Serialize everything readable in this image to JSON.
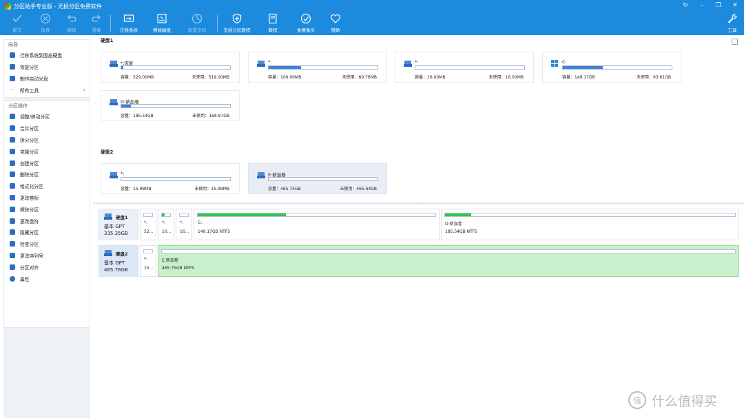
{
  "window": {
    "title": "分区助手专业版 - 无损分区免费软件"
  },
  "toolbar": {
    "buttons": [
      {
        "label": "提交",
        "icon": "check-icon",
        "enabled": false
      },
      {
        "label": "放弃",
        "icon": "discard-icon",
        "enabled": false
      },
      {
        "label": "撤销",
        "icon": "undo-icon",
        "enabled": false
      },
      {
        "label": "重做",
        "icon": "redo-icon",
        "enabled": false
      },
      {
        "label": "迁移系统",
        "icon": "migrate-os-icon",
        "enabled": true
      },
      {
        "label": "擦除磁盘",
        "icon": "wipe-disk-icon",
        "enabled": true
      },
      {
        "label": "配置空间",
        "icon": "allocate-space-icon",
        "enabled": false
      },
      {
        "label": "无损分区教程",
        "icon": "shield-icon",
        "enabled": true
      },
      {
        "label": "教程",
        "icon": "book-icon",
        "enabled": true
      },
      {
        "label": "免费备份",
        "icon": "backup-icon",
        "enabled": true
      },
      {
        "label": "赞助",
        "icon": "heart-icon",
        "enabled": true
      }
    ],
    "tools_label": "工具"
  },
  "sidebar": {
    "wizard_header": "向导",
    "wizard_items": [
      "迁移系统到固态硬盘",
      "恢复分区",
      "制作启动光盘",
      "所有工具"
    ],
    "ops_header": "分区操作",
    "ops_items": [
      "调整/移动分区",
      "合并分区",
      "拆分分区",
      "克隆分区",
      "创建分区",
      "删除分区",
      "格式化分区",
      "更改卷标",
      "擦除分区",
      "更改盘符",
      "隐藏分区",
      "检查分区",
      "更改序列号",
      "分区对齐",
      "属性"
    ]
  },
  "disks_view": {
    "disk1_label": "硬盘1",
    "disk1_partitions": [
      {
        "name": "*:恢复",
        "capacity": "容量：529.00MB",
        "free": "未使用：519.00MB",
        "used_fraction": 0.02
      },
      {
        "name": "*:",
        "capacity": "容量：100.00MB",
        "free": "未使用：69.76MB",
        "used_fraction": 0.3
      },
      {
        "name": "*:",
        "capacity": "容量：16.00MB",
        "free": "未使用：16.00MB",
        "used_fraction": 0.0
      },
      {
        "name": "C:",
        "capacity": "容量：149.17GB",
        "free": "未使用：93.61GB",
        "used_fraction": 0.37
      },
      {
        "name": "D:新加卷",
        "capacity": "容量：185.54GB",
        "free": "未使用：168.87GB",
        "used_fraction": 0.09
      }
    ],
    "disk2_label": "硬盘2",
    "disk2_partitions": [
      {
        "name": "*:",
        "capacity": "容量：15.98MB",
        "free": "未使用：15.98MB",
        "used_fraction": 0.0
      },
      {
        "name": "E:新加卷",
        "capacity": "容量：465.75GB",
        "free": "未使用：465.64GB",
        "used_fraction": 0.0
      }
    ]
  },
  "disk_map": {
    "disk1": {
      "name": "硬盘1",
      "type": "基本 GPT",
      "size": "335.35GB",
      "partitions": [
        {
          "name": "*:",
          "info": "52...",
          "used_fraction": 0.0
        },
        {
          "name": "*:",
          "info": "10...",
          "used_fraction": 0.3
        },
        {
          "name": "*:",
          "info": "16...",
          "used_fraction": 0.0
        },
        {
          "name": "C:",
          "info": "149.17GB NTFS",
          "used_fraction": 0.37
        },
        {
          "name": "D:新加卷",
          "info": "185.54GB NTFS",
          "used_fraction": 0.09
        }
      ]
    },
    "disk2": {
      "name": "硬盘2",
      "type": "基本 GPT",
      "size": "465.76GB",
      "partitions": [
        {
          "name": "*:",
          "info": "15...",
          "used_fraction": 0.0
        },
        {
          "name": "E:新加卷",
          "info": "465.75GB NTFS",
          "used_fraction": 0.0
        }
      ]
    }
  },
  "watermark": {
    "text": "什么值得买",
    "logo": "值"
  },
  "colors": {
    "accent": "#1c8bde",
    "bar_blue": "#3f82d8",
    "bar_green": "#31c451",
    "selected_green": "#c9f0cd"
  }
}
